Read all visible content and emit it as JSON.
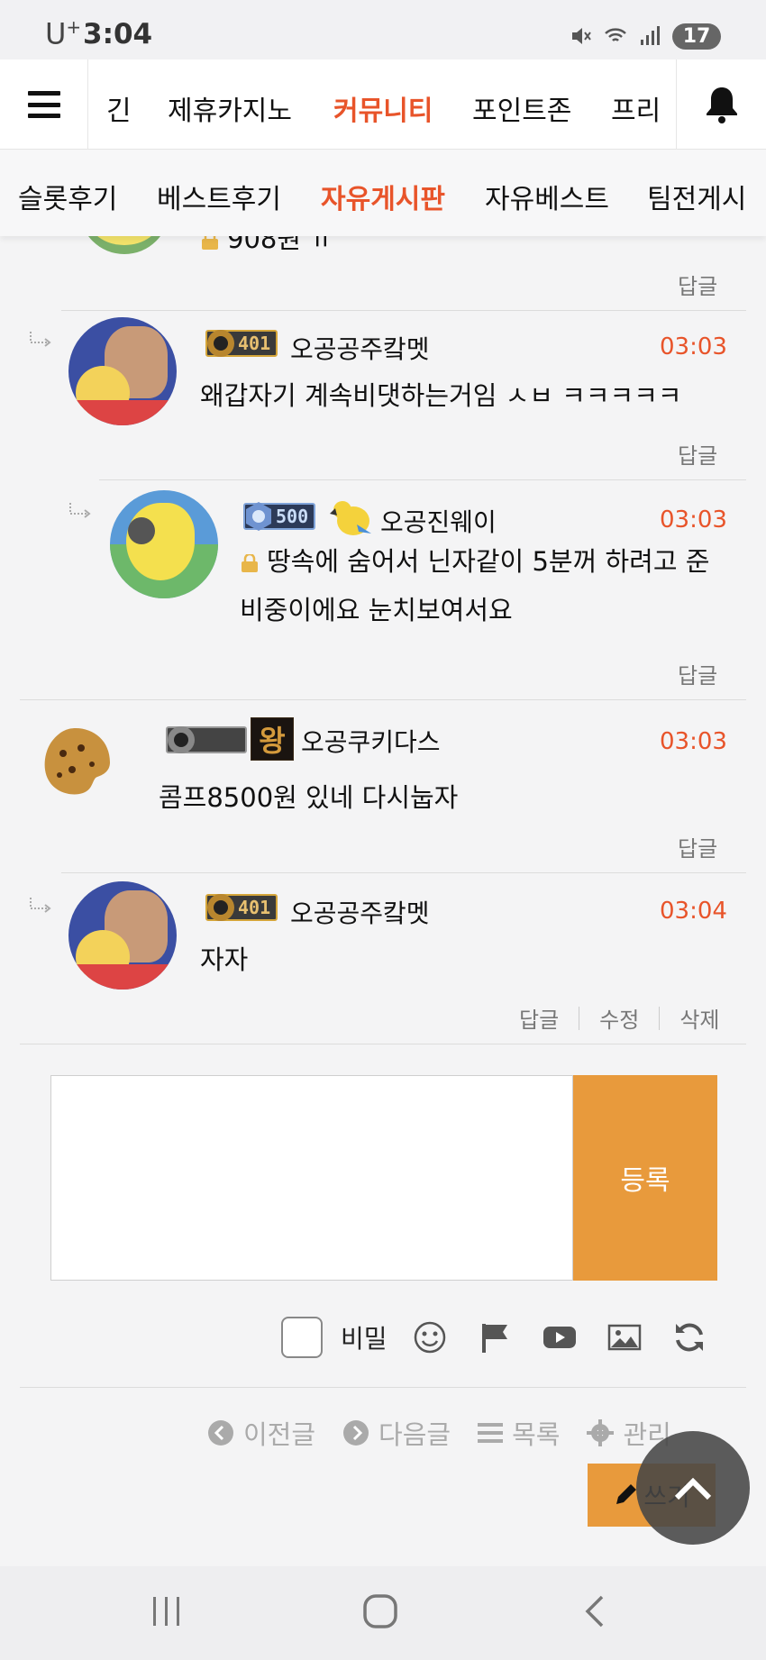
{
  "status_bar": {
    "carrier": "U",
    "carrier_sup": "+",
    "time": "3:04",
    "battery": "17"
  },
  "top_nav": {
    "items": [
      "긴",
      "제휴카지노",
      "커뮤니티",
      "포인트존",
      "프리"
    ],
    "active": "커뮤니티"
  },
  "sub_nav": {
    "items": [
      "슬롯후기",
      "베스트후기",
      "자유게시판",
      "자유베스트",
      "팀전게시"
    ],
    "active": "자유게시판"
  },
  "partial_comment": {
    "text": "908원 ㅠ",
    "reply_label": "답글"
  },
  "comments": [
    {
      "level": "401",
      "nickname": "오공공주캌멧",
      "time": "03:03",
      "text": "왜갑자기 계속비댓하는거임 ㅅㅂ ㅋㅋㅋㅋㅋ",
      "reply_label": "답글"
    },
    {
      "level": "500",
      "nickname": "오공진웨이",
      "time": "03:03",
      "text_line1": "땅속에 숨어서 닌자같이 5분꺼 하려고 준",
      "text_line2": "비중이에요 눈치보여서요",
      "reply_label": "답글"
    },
    {
      "level": "",
      "rank_badge": "왕",
      "nickname": "오공쿠키다스",
      "time": "03:03",
      "text": "콤프8500원 있네 다시눕자",
      "reply_label": "답글"
    },
    {
      "level": "401",
      "nickname": "오공공주캌멧",
      "time": "03:04",
      "text": "자자",
      "reply_label": "답글",
      "edit_label": "수정",
      "delete_label": "삭제"
    }
  ],
  "form": {
    "submit_label": "등록",
    "secret_label": "비밀",
    "tools": [
      "emoji-icon",
      "flag-icon",
      "youtube-icon",
      "image-icon",
      "refresh-icon"
    ]
  },
  "post_nav": {
    "prev_label": "이전글",
    "next_label": "다음글",
    "list_label": "목록",
    "admin_label": "관리",
    "write_label": "쓰기"
  },
  "colors": {
    "accent": "#e8542a",
    "button": "#e89a3c"
  }
}
